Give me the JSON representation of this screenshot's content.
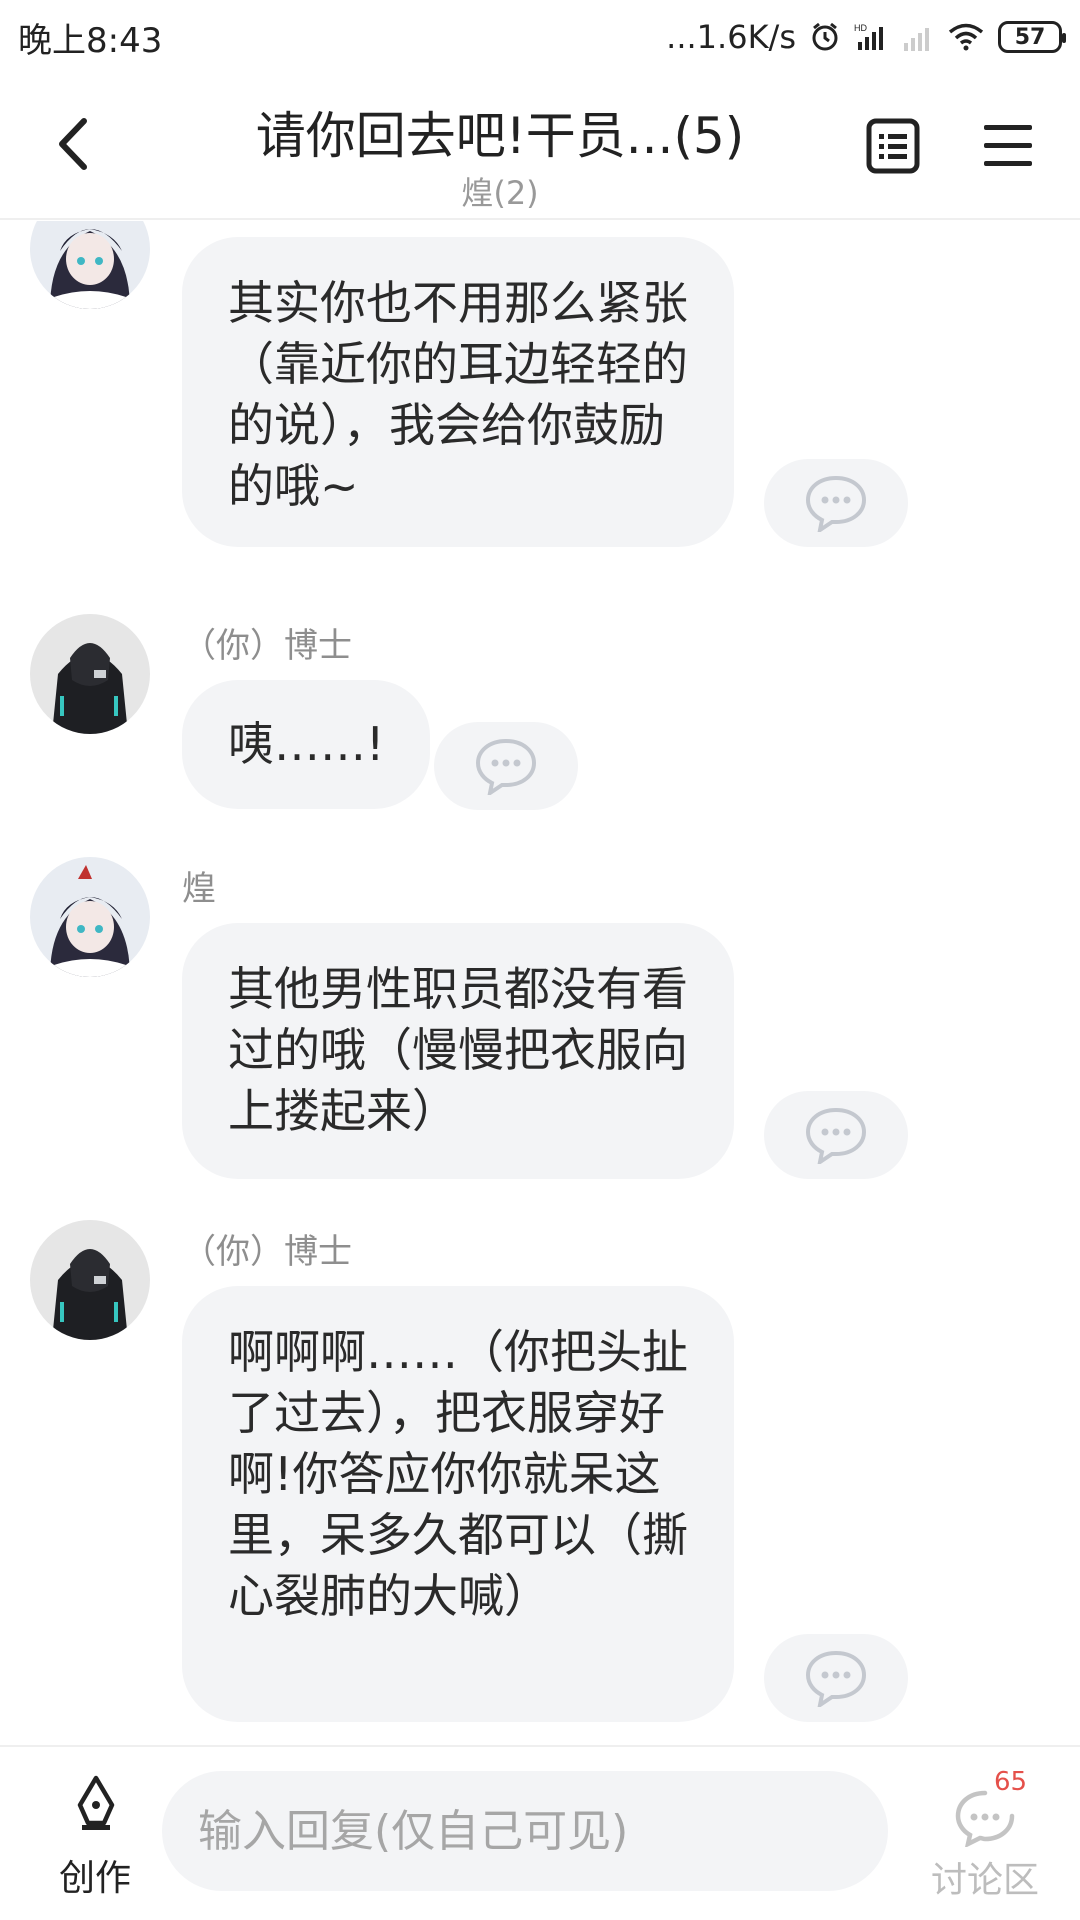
{
  "status_bar": {
    "time": "晚上8:43",
    "network_speed": "...1.6K/s",
    "battery": "57"
  },
  "header": {
    "title": "请你回去吧!干员...(5)",
    "subtitle": "煌(2)"
  },
  "messages": [
    {
      "sender": "",
      "text": "其实你也不用那么紧张（靠近你的耳边轻轻的的说），我会给你鼓励的哦~"
    },
    {
      "sender": "（你）博士",
      "text": "咦……!"
    },
    {
      "sender": "煌",
      "text": "其他男性职员都没有看过的哦（慢慢把衣服向上搂起来）"
    },
    {
      "sender": "（你）博士",
      "text": "啊啊啊……（你把头扯了过去），把衣服穿好啊!你答应你你就呆这里，呆多久都可以（撕心裂肺的大喊）"
    }
  ],
  "bottom_bar": {
    "create_label": "创作",
    "reply_placeholder": "输入回复(仅自己可见)",
    "discuss_label": "讨论区",
    "discuss_count": "65"
  },
  "icons": {
    "back": "chevron-left-icon",
    "list": "list-icon",
    "menu": "menu-icon",
    "comment": "comment-bubble-icon",
    "create": "pen-nib-icon",
    "discuss": "chat-bubble-icon"
  },
  "colors": {
    "bubble_bg": "#f3f4f6",
    "accent_red": "#e5504a"
  }
}
